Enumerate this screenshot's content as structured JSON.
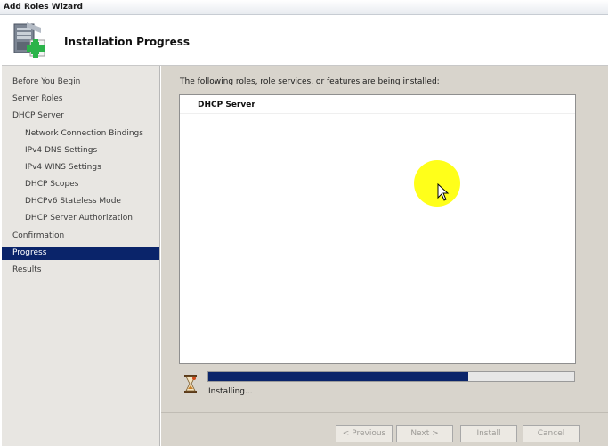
{
  "window": {
    "title": "Add Roles Wizard"
  },
  "header": {
    "title": "Installation Progress"
  },
  "nav": {
    "items": [
      {
        "label": "Before You Begin",
        "level": 0,
        "active": false
      },
      {
        "label": "Server Roles",
        "level": 0,
        "active": false
      },
      {
        "label": "DHCP Server",
        "level": 0,
        "active": false
      },
      {
        "label": "Network Connection Bindings",
        "level": 1,
        "active": false
      },
      {
        "label": "IPv4 DNS Settings",
        "level": 1,
        "active": false
      },
      {
        "label": "IPv4 WINS Settings",
        "level": 1,
        "active": false
      },
      {
        "label": "DHCP Scopes",
        "level": 1,
        "active": false
      },
      {
        "label": "DHCPv6 Stateless Mode",
        "level": 1,
        "active": false
      },
      {
        "label": "DHCP Server Authorization",
        "level": 1,
        "active": false
      },
      {
        "label": "Confirmation",
        "level": 0,
        "active": false
      },
      {
        "label": "Progress",
        "level": 0,
        "active": true
      },
      {
        "label": "Results",
        "level": 0,
        "active": false
      }
    ]
  },
  "main": {
    "description": "The following roles, role services, or features are being installed:",
    "items": [
      "DHCP Server"
    ],
    "progress": {
      "fraction": 0.71,
      "status": "Installing..."
    }
  },
  "buttons": {
    "previous": "< Previous",
    "next": "Next >",
    "install": "Install",
    "cancel": "Cancel"
  },
  "colors": {
    "selection": "#0a246a",
    "progress_fill": "#0a246a",
    "cursor_highlight": "#ffff1a"
  }
}
